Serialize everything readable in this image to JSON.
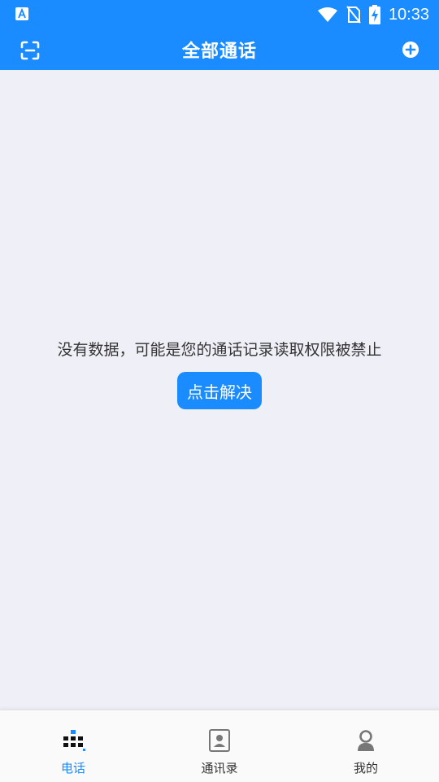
{
  "status_bar": {
    "time": "10:33"
  },
  "header": {
    "title": "全部通话"
  },
  "empty_state": {
    "message": "没有数据，可能是您的通话记录读取权限被禁止",
    "button_label": "点击解决"
  },
  "bottom_nav": {
    "items": [
      {
        "label": "电话",
        "icon": "dialpad-icon",
        "active": true
      },
      {
        "label": "通讯录",
        "icon": "contacts-icon",
        "active": false
      },
      {
        "label": "我的",
        "icon": "profile-icon",
        "active": false
      }
    ]
  },
  "colors": {
    "accent": "#1a8cff",
    "background": "#eff0f7",
    "nav_background": "#fafafa"
  }
}
